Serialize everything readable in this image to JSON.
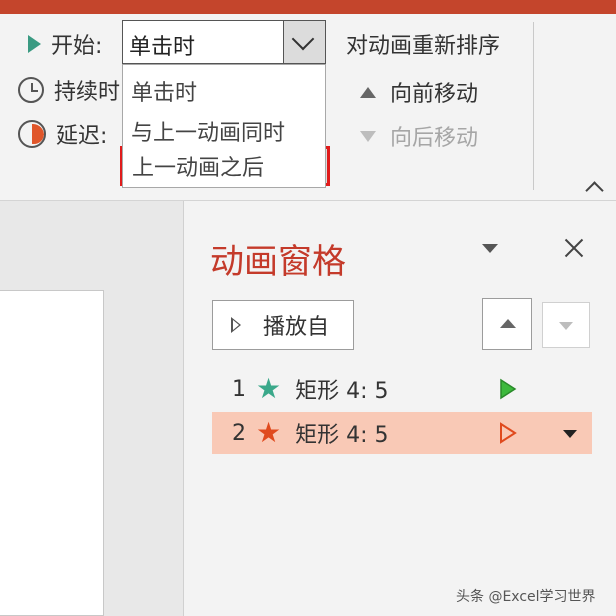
{
  "timing": {
    "start_label": "开始:",
    "duration_label": "持续时",
    "delay_label": "延迟:",
    "start_value": "单击时"
  },
  "start_dropdown": {
    "options": [
      "单击时",
      "与上一动画同时",
      "上一动画之后"
    ],
    "highlight_color": "#e01b1b"
  },
  "reorder": {
    "title": "对动画重新排序",
    "move_forward": "向前移动",
    "move_backward": "向后移动"
  },
  "animation_pane": {
    "title": "动画窗格",
    "play_from_label": "播放自",
    "items": [
      {
        "number": "1",
        "label": "矩形 4: 5",
        "star_color": "#3aa88a",
        "play_color": "#3cb93c"
      },
      {
        "number": "2",
        "label": "矩形 4: 5",
        "star_color": "#e04a1e",
        "play_color": "#e04a1e",
        "selected": true
      }
    ],
    "selected_row_color": "#f9c9b6"
  },
  "colors": {
    "title_bar": "#c4452c",
    "accent_red": "#c43a2a"
  },
  "watermark": "头条 @Excel学习世界",
  "icons": [
    "play-icon",
    "clock-icon",
    "delay-icon",
    "chevron-down-icon",
    "triangle-up-icon",
    "triangle-down-icon",
    "close-icon",
    "star-icon"
  ]
}
